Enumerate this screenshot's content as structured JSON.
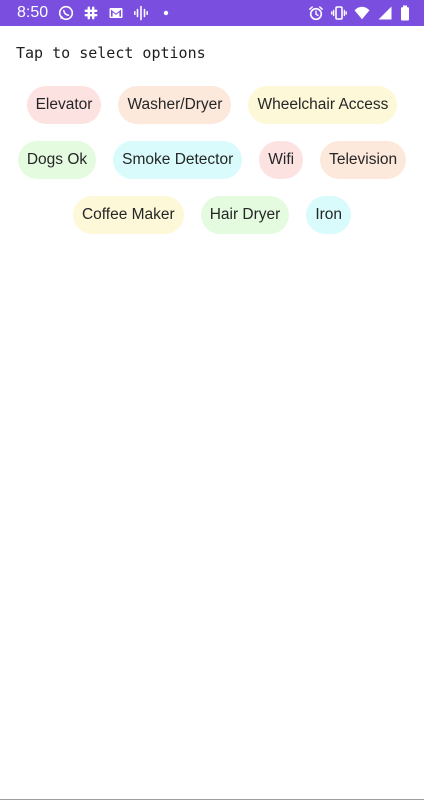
{
  "status_bar": {
    "time": "8:50",
    "background": "#7a4fe0",
    "left_icons": [
      "whatsapp-icon",
      "slack-icon",
      "gmail-icon",
      "podcast-icon",
      "notification-dot-icon"
    ],
    "right_icons": [
      "alarm-icon",
      "vibrate-icon",
      "wifi-icon",
      "cell-signal-icon",
      "battery-icon"
    ]
  },
  "prompt": "Tap to select options",
  "chip_rows": [
    [
      {
        "label": "Elevator",
        "color": "#fde2e2"
      },
      {
        "label": "Washer/Dryer",
        "color": "#fde8dc"
      },
      {
        "label": "Wheelchair Access",
        "color": "#fdf8d8"
      }
    ],
    [
      {
        "label": "Dogs Ok",
        "color": "#e4fbe0"
      },
      {
        "label": "Smoke Detector",
        "color": "#d9fbfb"
      },
      {
        "label": "Wifi",
        "color": "#fde2e2"
      },
      {
        "label": "Television",
        "color": "#fde8dc"
      }
    ],
    [
      {
        "label": "Coffee Maker",
        "color": "#fdf8d8"
      },
      {
        "label": "Hair Dryer",
        "color": "#e4fbe0"
      },
      {
        "label": "Iron",
        "color": "#d9fbfb"
      }
    ]
  ]
}
